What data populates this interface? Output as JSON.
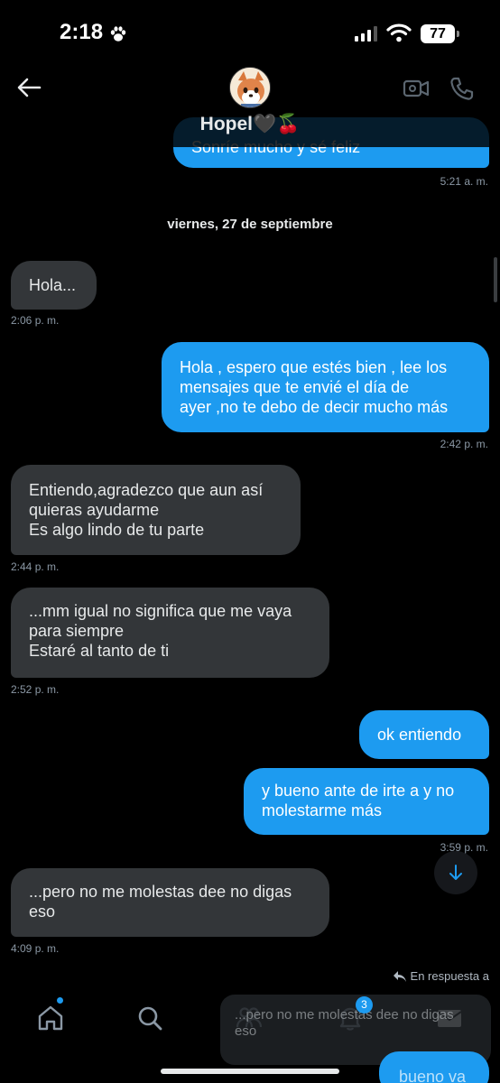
{
  "status_bar": {
    "time": "2:18",
    "battery": "77"
  },
  "header": {
    "contact_name": "Hopel🖤🍒"
  },
  "date_separator": "viernes, 27 de septiembre",
  "messages": [
    {
      "text": "Sonríe mucho y sé feliz",
      "time": "5:21 a. m."
    },
    {
      "text": "Hola...",
      "time": "2:06 p. m."
    },
    {
      "text": "Hola , espero que estés bien , lee los\nmensajes que te envié el día de\nayer  ,no te debo de decir mucho más",
      "time": "2:42 p. m."
    },
    {
      "text": "Entiendo,agradezco que aun así\nquieras ayudarme\nEs algo lindo de tu parte",
      "time": "2:44 p. m."
    },
    {
      "text": "...mm igual no significa que me vaya\npara siempre\nEstaré al tanto de ti",
      "time": "2:52 p. m."
    },
    {
      "text": "ok entiendo",
      "time": ""
    },
    {
      "text": "y bueno ante de irte a y no\nmolestarme más",
      "time": "3:59 p. m."
    },
    {
      "text": "...pero no me molestas dee no digas\neso",
      "time": "4:09 p. m."
    }
  ],
  "reply": {
    "label": "En respuesta a",
    "quoted": "...pero no me molestas dee no digas eso",
    "draft": "bueno va"
  },
  "nav": {
    "notifications_count": "3"
  },
  "colors": {
    "accent": "#1d9bf0",
    "incoming_bubble": "#333639",
    "background": "#000000"
  }
}
